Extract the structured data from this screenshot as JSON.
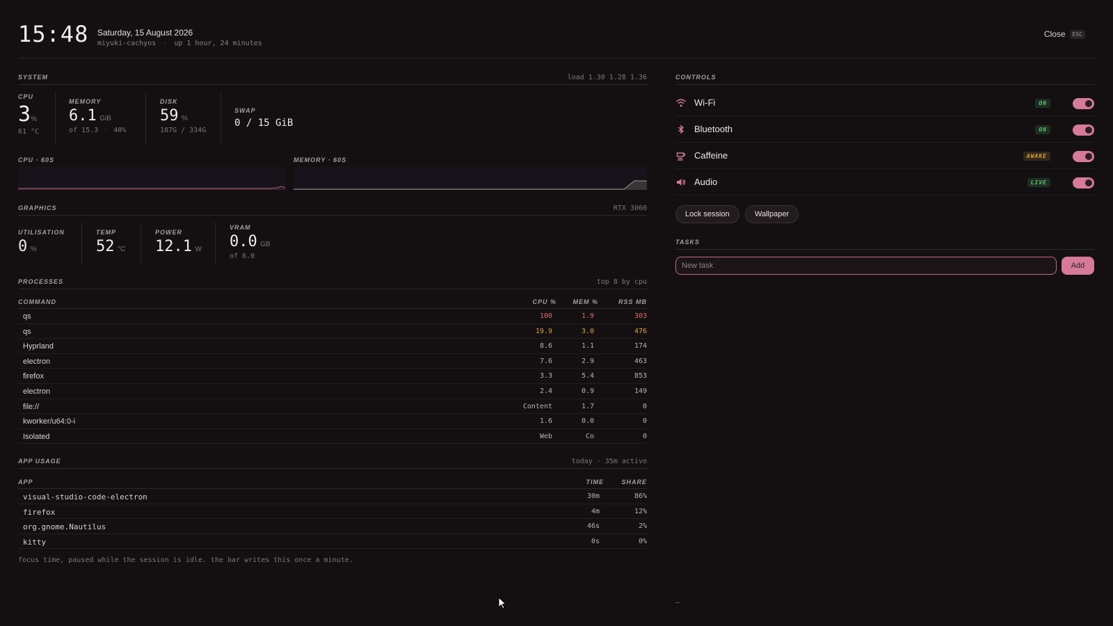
{
  "header": {
    "time": "15:48",
    "date": "Saturday, 15 August 2026",
    "hostname": "miyuki-cachyos",
    "uptime": "up 1 hour, 24 minutes",
    "close_label": "Close",
    "close_key": "ESC"
  },
  "system": {
    "title": "SYSTEM",
    "load": "load 1.30 1.28 1.36",
    "cpu": {
      "label": "CPU",
      "value": "3",
      "unit": "%",
      "sub": "61 °C"
    },
    "memory": {
      "label": "MEMORY",
      "value": "6.1",
      "unit": "GiB",
      "sub_of": "of 15.3",
      "sub_pct": "40%"
    },
    "disk": {
      "label": "DISK",
      "value": "59",
      "unit": "%",
      "sub": "187G / 334G"
    },
    "swap": {
      "label": "SWAP",
      "value": "0 / 15 GiB"
    },
    "cpu_spark_label": "CPU · 60S",
    "mem_spark_label": "MEMORY · 60S"
  },
  "graphics": {
    "title": "GRAPHICS",
    "gpu": "RTX 3060",
    "utilisation": {
      "label": "UTILISATION",
      "value": "0",
      "unit": "%"
    },
    "temp": {
      "label": "TEMP",
      "value": "52",
      "unit": "°C"
    },
    "power": {
      "label": "POWER",
      "value": "12.1",
      "unit": "W"
    },
    "vram": {
      "label": "VRAM",
      "value": "0.0",
      "unit": "GB",
      "sub": "of 6.0"
    }
  },
  "processes": {
    "title": "PROCESSES",
    "note": "top 8 by cpu",
    "columns": [
      "COMMAND",
      "CPU %",
      "MEM %",
      "RSS MB"
    ],
    "rows": [
      {
        "command": "qs",
        "cpu": "100",
        "mem": "1.9",
        "rss": "303",
        "level": "red"
      },
      {
        "command": "qs",
        "cpu": "19.9",
        "mem": "3.0",
        "rss": "476",
        "level": "amber"
      },
      {
        "command": "Hyprland",
        "cpu": "8.6",
        "mem": "1.1",
        "rss": "174",
        "level": ""
      },
      {
        "command": "electron",
        "cpu": "7.6",
        "mem": "2.9",
        "rss": "463",
        "level": ""
      },
      {
        "command": "firefox",
        "cpu": "3.3",
        "mem": "5.4",
        "rss": "853",
        "level": ""
      },
      {
        "command": "electron",
        "cpu": "2.4",
        "mem": "0.9",
        "rss": "149",
        "level": ""
      },
      {
        "command": "file://",
        "cpu": "Content",
        "mem": "1.7",
        "rss": "0",
        "level": ""
      },
      {
        "command": "kworker/u64:0-i",
        "cpu": "1.6",
        "mem": "0.0",
        "rss": "0",
        "level": ""
      },
      {
        "command": "Isolated",
        "cpu": "Web",
        "mem": "Co",
        "rss": "0",
        "level": ""
      }
    ]
  },
  "app_usage": {
    "title": "APP USAGE",
    "note": "today · 35m active",
    "columns": [
      "APP",
      "TIME",
      "SHARE"
    ],
    "rows": [
      {
        "app": "visual-studio-code-electron",
        "time": "30m",
        "share": "86%"
      },
      {
        "app": "firefox",
        "time": "4m",
        "share": "12%"
      },
      {
        "app": "org.gnome.Nautilus",
        "time": "46s",
        "share": "2%"
      },
      {
        "app": "kitty",
        "time": "0s",
        "share": "0%"
      }
    ],
    "footnote": "focus time, paused while the session is idle. the bar writes this once a minute."
  },
  "controls": {
    "title": "CONTROLS",
    "items": [
      {
        "label": "Wi-Fi",
        "badge": "ON",
        "badge_color": "green",
        "icon": "wifi-icon",
        "on": true
      },
      {
        "label": "Bluetooth",
        "badge": "ON",
        "badge_color": "green",
        "icon": "bluetooth-icon",
        "on": true
      },
      {
        "label": "Caffeine",
        "badge": "AWAKE",
        "badge_color": "amber",
        "icon": "coffee-icon",
        "on": true
      },
      {
        "label": "Audio",
        "badge": "LIVE",
        "badge_color": "green",
        "icon": "speaker-icon",
        "on": true
      }
    ],
    "lock_label": "Lock session",
    "wallpaper_label": "Wallpaper"
  },
  "tasks": {
    "title": "TASKS",
    "placeholder": "New task",
    "add_label": "Add"
  },
  "colors": {
    "accent": "#d77a9a",
    "background": "#141012",
    "hot_red": "#e06b6b",
    "hot_amber": "#d9a441",
    "ok_green": "#5fbf72"
  }
}
